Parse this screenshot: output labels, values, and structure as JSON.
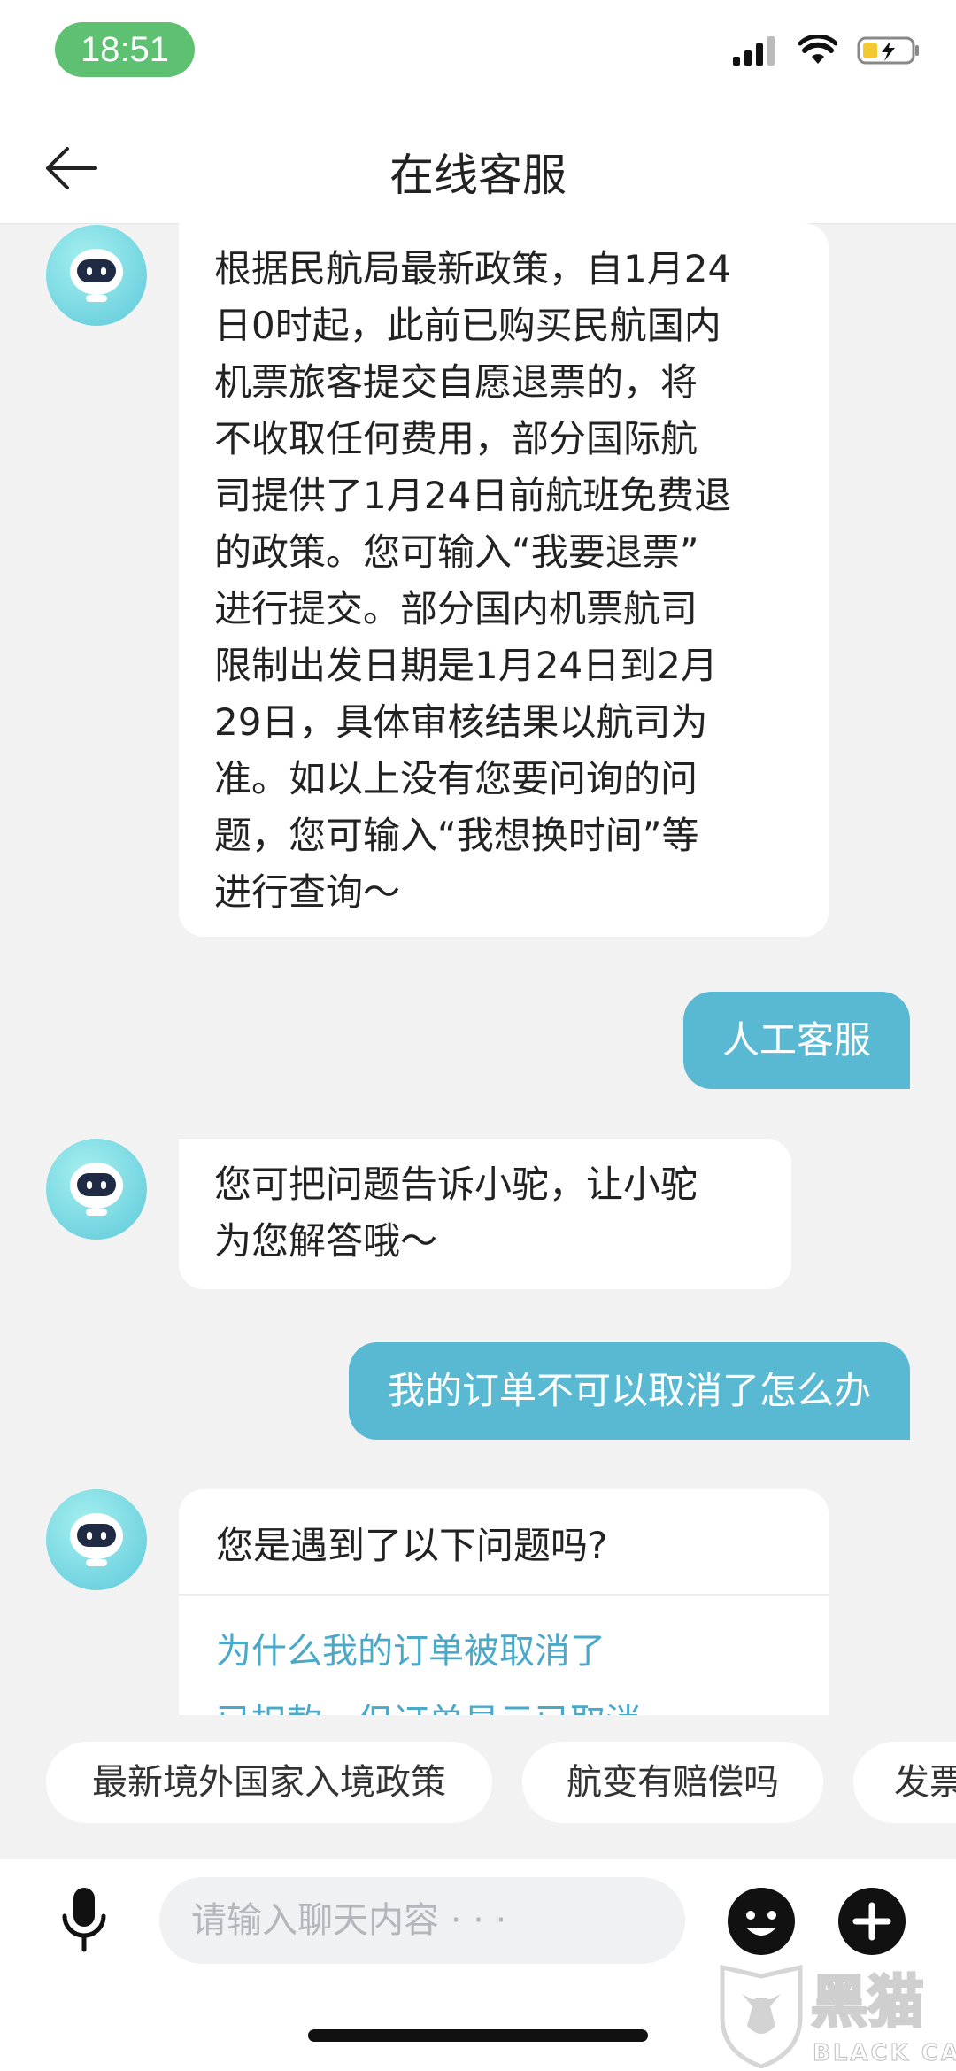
{
  "status_bar": {
    "time": "18:51"
  },
  "header": {
    "title": "在线客服"
  },
  "messages": {
    "bot_1": [
      "根据民航局最新政策，自1月24",
      "日0时起，此前已购买民航国内",
      "机票旅客提交自愿退票的，将",
      "不收取任何费用，部分国际航",
      "司提供了1月24日前航班免费退",
      "的政策。您可输入“我要退票”",
      "进行提交。部分国内机票航司",
      "限制出发日期是1月24日到2月",
      "29日，具体审核结果以航司为",
      "准。如以上没有您要问询的问",
      "题，您可输入“我想换时间”等",
      "进行查询～"
    ],
    "user_1": "人工客服",
    "bot_2": [
      "您可把问题告诉小驼，让小驼",
      "为您解答哦～"
    ],
    "user_2": "我的订单不可以取消了怎么办",
    "bot_3_title": "您是遇到了以下问题吗?",
    "bot_3_options": [
      "为什么我的订单被取消了",
      "已扣款，但订单显示已取消"
    ]
  },
  "quick_replies": [
    "最新境外国家入境政策",
    "航变有赔偿吗",
    "发票"
  ],
  "input_bar": {
    "placeholder": "请输入聊天内容 · · ·"
  },
  "watermark": {
    "text": "黑猫",
    "sub": "BLACK CAT"
  },
  "colors": {
    "accent": "#5ab9d2",
    "link": "#4aa9c8",
    "time_pill": "#5ec172"
  },
  "icons": [
    "back-arrow-icon",
    "signal-icon",
    "wifi-icon",
    "battery-icon",
    "robot-avatar-icon",
    "microphone-icon",
    "emoji-icon",
    "plus-icon"
  ]
}
